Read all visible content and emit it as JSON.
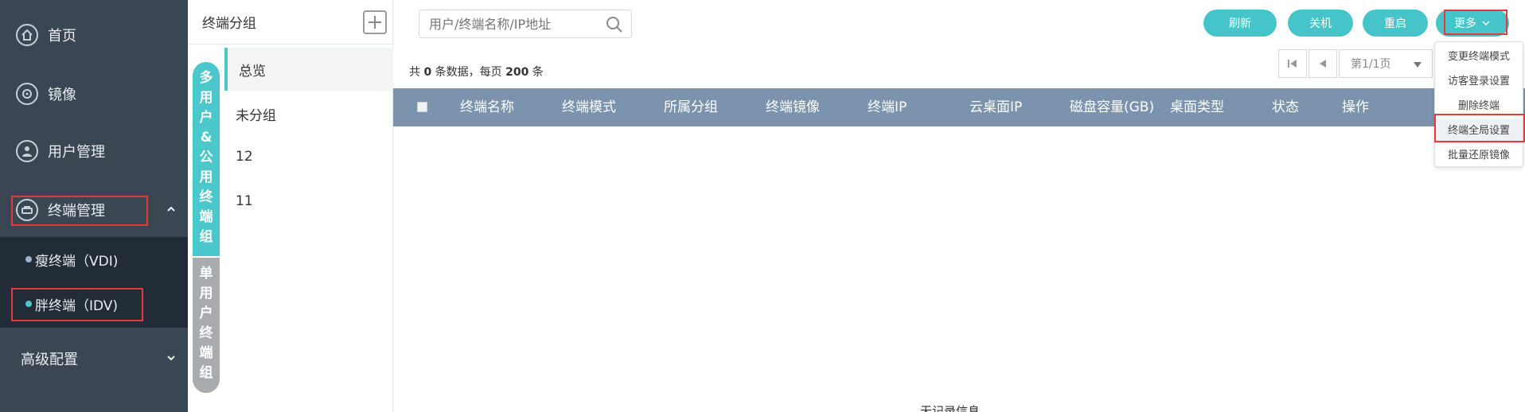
{
  "sidebar": {
    "items": [
      {
        "label": "首页",
        "icon": "home-icon"
      },
      {
        "label": "镜像",
        "icon": "image-icon"
      },
      {
        "label": "用户管理",
        "icon": "user-icon"
      },
      {
        "label": "终端管理",
        "icon": "terminal-icon"
      }
    ],
    "sub_items": [
      {
        "label": "瘦终端（VDI)",
        "dot_color": "#9fb3c8"
      },
      {
        "label": "胖终端（IDV)",
        "dot_color": "#4cc7cc"
      }
    ],
    "advanced": "高级配置"
  },
  "groups": {
    "title": "终端分组",
    "tab_multi": [
      "多",
      "用",
      "户",
      "&",
      "公",
      "用",
      "终",
      "端",
      "组"
    ],
    "tab_single": [
      "单",
      "用",
      "户",
      "终",
      "端",
      "组"
    ],
    "list": [
      "总览",
      "未分组",
      "12",
      "11"
    ]
  },
  "search": {
    "placeholder": "用户/终端名称/IP地址"
  },
  "toolbar": {
    "refresh": "刷新",
    "shutdown": "关机",
    "restart": "重启",
    "more": "更多"
  },
  "summary": {
    "prefix": "共",
    "count": "0",
    "mid": "条数据，每页",
    "per_page": "200",
    "suffix": "条"
  },
  "pager": {
    "page_label": "第1/1页"
  },
  "table": {
    "columns": [
      "终端名称",
      "终端模式",
      "所属分组",
      "终端镜像",
      "终端IP",
      "云桌面IP",
      "磁盘容量(GB)",
      "桌面类型",
      "状态",
      "操作"
    ],
    "empty": "无记录信息"
  },
  "dropdown": [
    "变更终端模式",
    "访客登录设置",
    "删除终端",
    "终端全局设置",
    "批量还原镜像"
  ],
  "colors": {
    "accent": "#45c5c9",
    "sidebar": "#3a4652",
    "header": "#7b93ad",
    "highlight": "#e23b3b"
  }
}
